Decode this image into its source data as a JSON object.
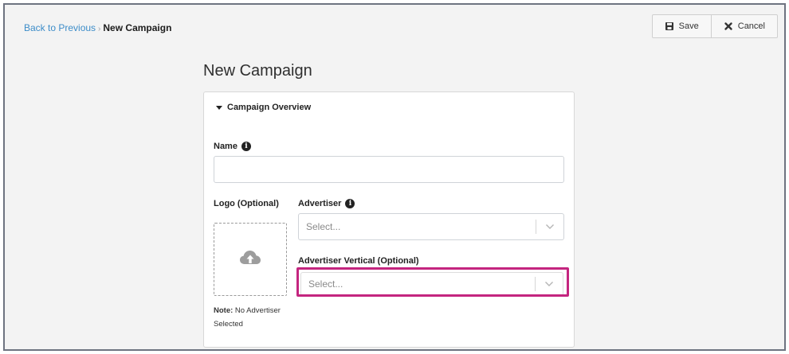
{
  "breadcrumb": {
    "back_label": "Back to Previous",
    "separator": "›",
    "current": "New Campaign"
  },
  "toolbar": {
    "save_label": "Save",
    "cancel_label": "Cancel"
  },
  "page": {
    "title": "New Campaign"
  },
  "section": {
    "title": "Campaign Overview"
  },
  "form": {
    "name_label": "Name",
    "name_value": "",
    "logo_label": "Logo (Optional)",
    "advertiser_label": "Advertiser",
    "advertiser_placeholder": "Select...",
    "vertical_label": "Advertiser Vertical (Optional)",
    "vertical_placeholder": "Select...",
    "note_label": "Note:",
    "note_text": "No Advertiser Selected"
  },
  "colors": {
    "link": "#3d8dc9",
    "highlight": "#c4257f",
    "background": "#f3f3f3"
  },
  "icons": [
    "save-icon",
    "cancel-icon",
    "info-icon",
    "upload-cloud-icon",
    "chevron-down-icon",
    "caret-down-icon"
  ]
}
